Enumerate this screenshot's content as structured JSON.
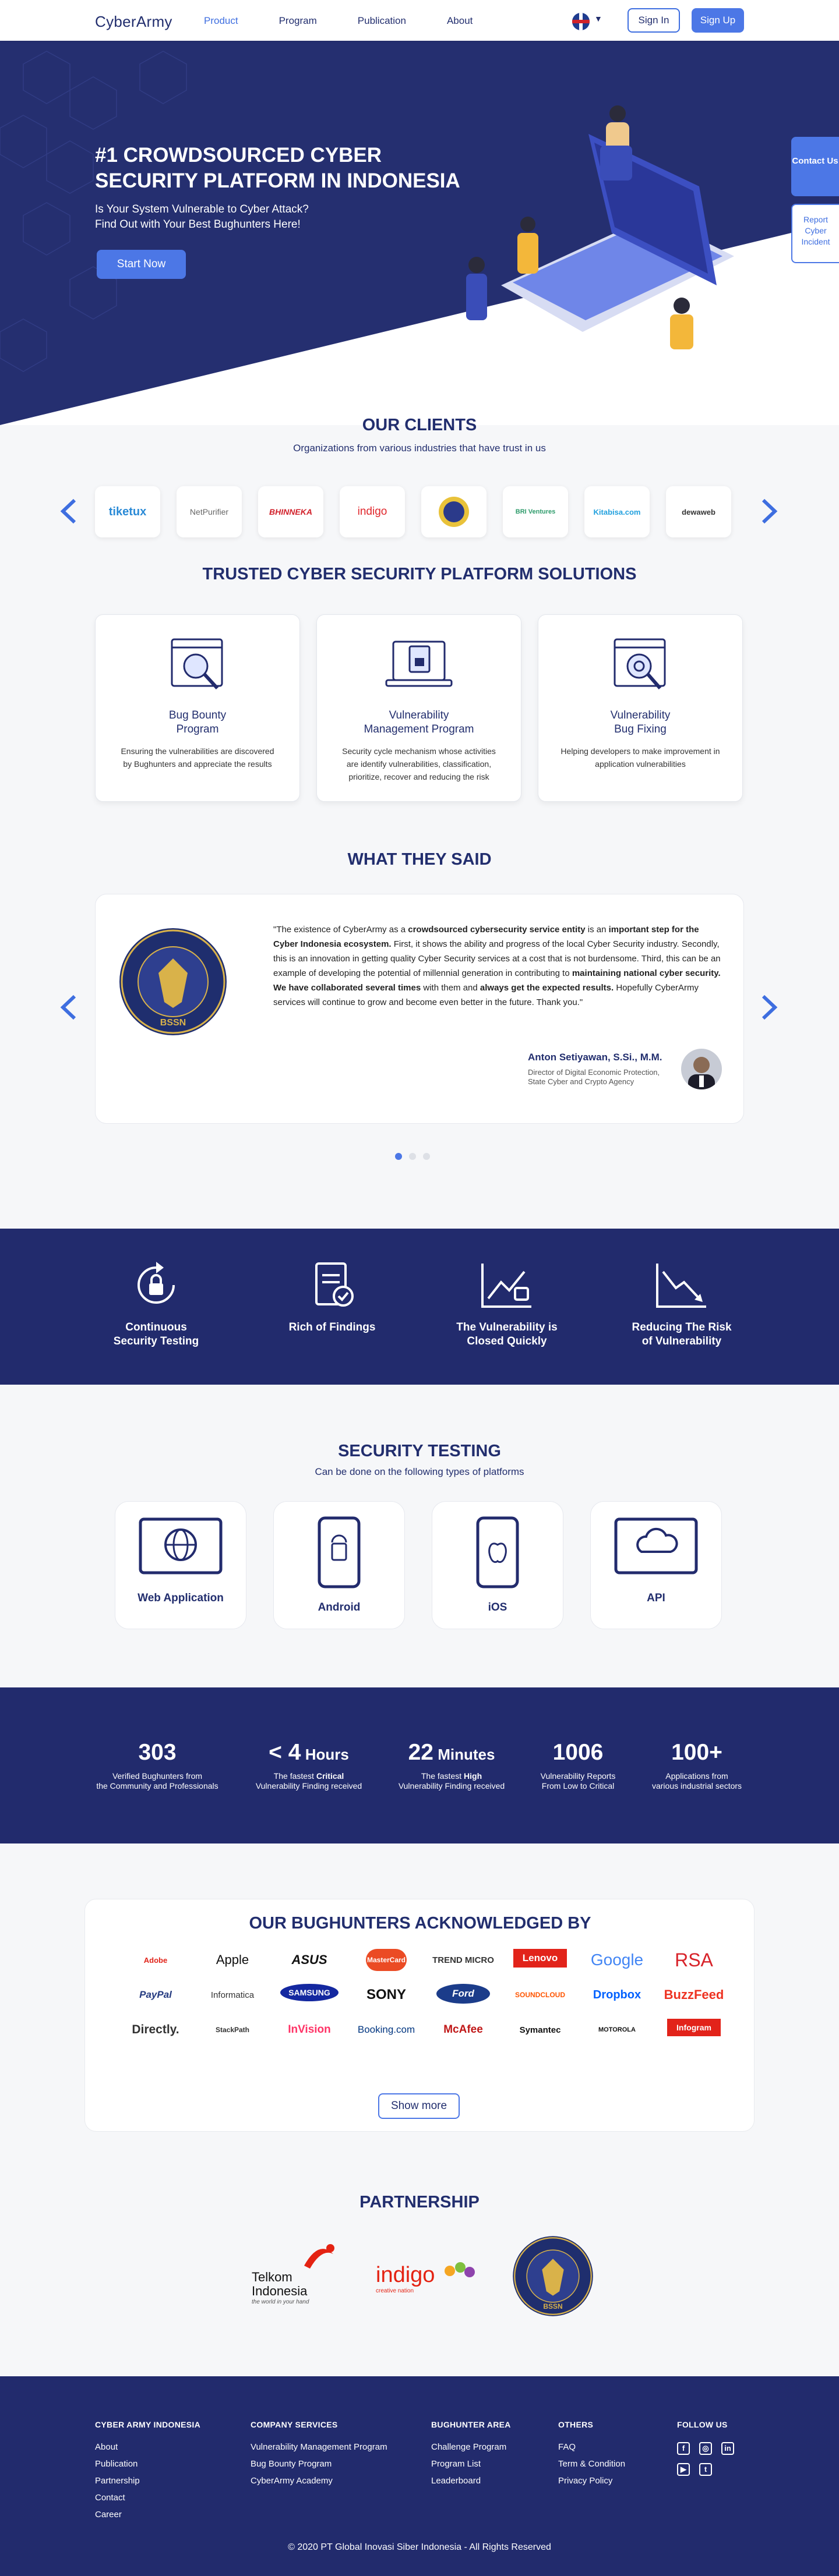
{
  "nav": {
    "logo": "CyberArmy",
    "items": [
      {
        "label": "Product"
      },
      {
        "label": "Program"
      },
      {
        "label": "Publication"
      },
      {
        "label": "About"
      }
    ],
    "signin": "Sign In",
    "signup": "Sign Up"
  },
  "hero": {
    "title": "#1 CROWDSOURCED CYBER SECURITY PLATFORM IN INDONESIA",
    "subtitle_line1": "Is Your System Vulnerable to Cyber Attack?",
    "subtitle_line2": "Find Out with Your Best Bughunters Here!",
    "cta": "Start Now"
  },
  "side": {
    "contact": "Contact Us",
    "report": "Report Cyber Incident"
  },
  "clients": {
    "title": "OUR CLIENTS",
    "subtitle": "Organizations from various industries that have trust in us",
    "logos": [
      "tiketux",
      "NetPurifier",
      "BHINNEKA",
      "indigo",
      "seal",
      "BRI Ventures",
      "Kitabisa.com",
      "dewaweb"
    ]
  },
  "solutions": {
    "title": "TRUSTED CYBER SECURITY PLATFORM SOLUTIONS",
    "cards": [
      {
        "title_line1": "Bug Bounty",
        "title_line2": "Program",
        "desc": "Ensuring the vulnerabilities are discovered by Bughunters and appreciate the results"
      },
      {
        "title_line1": "Vulnerability",
        "title_line2": "Management Program",
        "desc": "Security cycle mechanism whose activities are identify vulnerabilities, classification, prioritize, recover and  reducing the risk"
      },
      {
        "title_line1": "Vulnerability",
        "title_line2": "Bug Fixing",
        "desc": "Helping developers to make improvement in application vulnerabilities"
      }
    ]
  },
  "testimonial": {
    "title": "WHAT THEY SAID",
    "seal_text": "BADAN SIBER DAN SANDI NEGARA",
    "seal_abbr": "BSSN",
    "q1": "\"The existence of CyberArmy as a ",
    "q1b": "crowdsourced cybersecurity service entity",
    "q2": " is an ",
    "q2b": "important step for the Cyber Indonesia ecosystem.",
    "q3": " First, it shows the ability and progress of the local Cyber Security industry. Secondly, this is an innovation in getting quality Cyber Security services at a cost that is not burdensome. Third, this can be an example of developing the potential of millennial generation in contributing to ",
    "q3b": "maintaining national cyber security.",
    "q4": " ",
    "q4b": "We have collaborated several times",
    "q5": " with them and ",
    "q5b": "always get the expected results.",
    "q6": " Hopefully CyberArmy services will continue to grow and become even better in the future. Thank you.\"",
    "name": "Anton Setiyawan, S.Si., M.M.",
    "role": "Director of Digital Economic Protection, State Cyber and Crypto Agency"
  },
  "features": [
    {
      "line1": "Continuous",
      "line2": "Security Testing"
    },
    {
      "line1": "Rich of Findings",
      "line2": ""
    },
    {
      "line1": "The Vulnerability is",
      "line2": "Closed Quickly"
    },
    {
      "line1": "Reducing The Risk",
      "line2": "of Vulnerability"
    }
  ],
  "testing": {
    "title": "SECURITY TESTING",
    "subtitle": "Can be done on the following types of platforms",
    "platforms": [
      "Web Application",
      "Android",
      "iOS",
      "API"
    ]
  },
  "stats": [
    {
      "big": "303",
      "unit": "",
      "l1": "Verified Bughunters from",
      "l2": "the Community and Professionals",
      "pre": "",
      "bold": ""
    },
    {
      "big": "< 4",
      "unit": " Hours",
      "l1": "Vulnerability Finding received",
      "pre": "The fastest ",
      "bold": "Critical"
    },
    {
      "big": "22",
      "unit": " Minutes",
      "l1": "Vulnerability Finding received",
      "pre": "The fastest ",
      "bold": "High"
    },
    {
      "big": "1006",
      "unit": "",
      "l1": "Vulnerability Reports",
      "l2": "From Low to Critical",
      "pre": "",
      "bold": ""
    },
    {
      "big": "100+",
      "unit": "",
      "l1": "Applications from",
      "l2": "various industrial sectors",
      "pre": "",
      "bold": ""
    }
  ],
  "ack": {
    "title": "OUR BUGHUNTERS ACKNOWLEDGED BY",
    "brands": [
      "Adobe",
      "Apple",
      "ASUS",
      "MasterCard",
      "TREND MICRO",
      "Lenovo",
      "Google",
      "RSA",
      "PayPal",
      "Informatica",
      "SAMSUNG",
      "SONY",
      "Ford",
      "SOUNDCLOUD",
      "Dropbox",
      "BuzzFeed",
      "Directly.",
      "StackPath",
      "InVision",
      "Booking.com",
      "McAfee",
      "Symantec",
      "MOTOROLA",
      "Infogram"
    ],
    "show_more": "Show more"
  },
  "partnership": {
    "title": "PARTNERSHIP",
    "telkom1": "Telkom",
    "telkom2": "Indonesia",
    "telkom3": "the world in your hand",
    "indigo": "indigo",
    "indigo_sub": "creative nation"
  },
  "footer": {
    "cols": [
      {
        "title": "CYBER ARMY INDONESIA",
        "links": [
          "About",
          "Publication",
          "Partnership",
          "Contact",
          "Career"
        ]
      },
      {
        "title": "COMPANY SERVICES",
        "links": [
          "Vulnerability Management Program",
          "Bug Bounty Program",
          "CyberArmy Academy"
        ]
      },
      {
        "title": "BUGHUNTER AREA",
        "links": [
          "Challenge Program",
          "Program List",
          "Leaderboard"
        ]
      },
      {
        "title": "OTHERS",
        "links": [
          "FAQ",
          "Term & Condition",
          "Privacy Policy"
        ]
      }
    ],
    "follow": "FOLLOW US",
    "copyright": "© 2020 PT Global Inovasi Siber Indonesia - All Rights Reserved"
  },
  "colors": {
    "navy": "#222b6d",
    "blue": "#4c77e6",
    "text": "#222e6e"
  }
}
